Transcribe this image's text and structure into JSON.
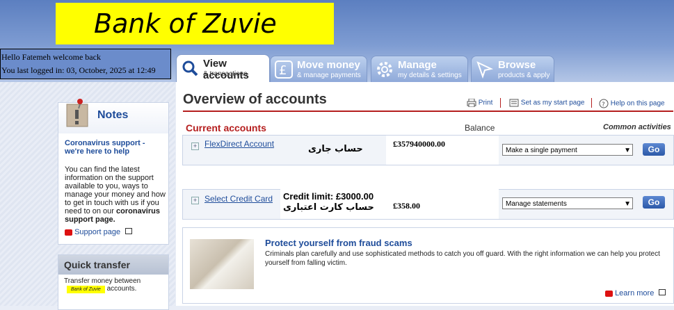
{
  "brand": {
    "logo_text": "Bank of Zuvie",
    "logo_color": "#ffff00"
  },
  "welcome": {
    "line1": "Hello Fatemeh welcome back",
    "line2": "You last logged in: 03, October, 2025 at 12:49"
  },
  "tabs": [
    {
      "title": "View accounts",
      "sub": "& transactions"
    },
    {
      "title": "Move money",
      "sub": "& manage payments"
    },
    {
      "title": "Manage",
      "sub": "my details & settings"
    },
    {
      "title": "Browse",
      "sub": "products & apply"
    }
  ],
  "notes": {
    "title": "Notes",
    "link1": "Coronavirus support - we're here to help",
    "body": "You can find the latest information on the support available to you, ways to manage your money and how to get in touch with us if you need to on our",
    "body_bold": "coronavirus support page.",
    "link2": "Support page"
  },
  "quick_transfer": {
    "title": "Quick transfer",
    "text_pre": "Transfer money between",
    "logo_small": "Bank of Zuvie",
    "text_post": "accounts."
  },
  "main": {
    "title": "Overview of accounts",
    "print": "Print",
    "start": "Set as my start page",
    "help": "Help on this page",
    "current_accounts": "Current accounts",
    "balance": "Balance",
    "common": "Common activities"
  },
  "accounts": [
    {
      "name": "FlexDirect Account",
      "farsi": "حساب جاری",
      "credit": "",
      "amount": "£357940000.00",
      "action": "Make a single payment",
      "go": "Go"
    },
    {
      "name": "Select Credit Card",
      "farsi": "حساب کارت اعتباری",
      "credit": "Credit limit: £3000.00",
      "amount": "£358.00",
      "action": "Manage statements",
      "go": "Go"
    }
  ],
  "fraud": {
    "title": "Protect yourself from fraud scams",
    "text": "Criminals plan carefully and use sophisticated methods to catch you off guard. With the right information we can help you protect yourself from falling victim.",
    "learn": "Learn more"
  }
}
